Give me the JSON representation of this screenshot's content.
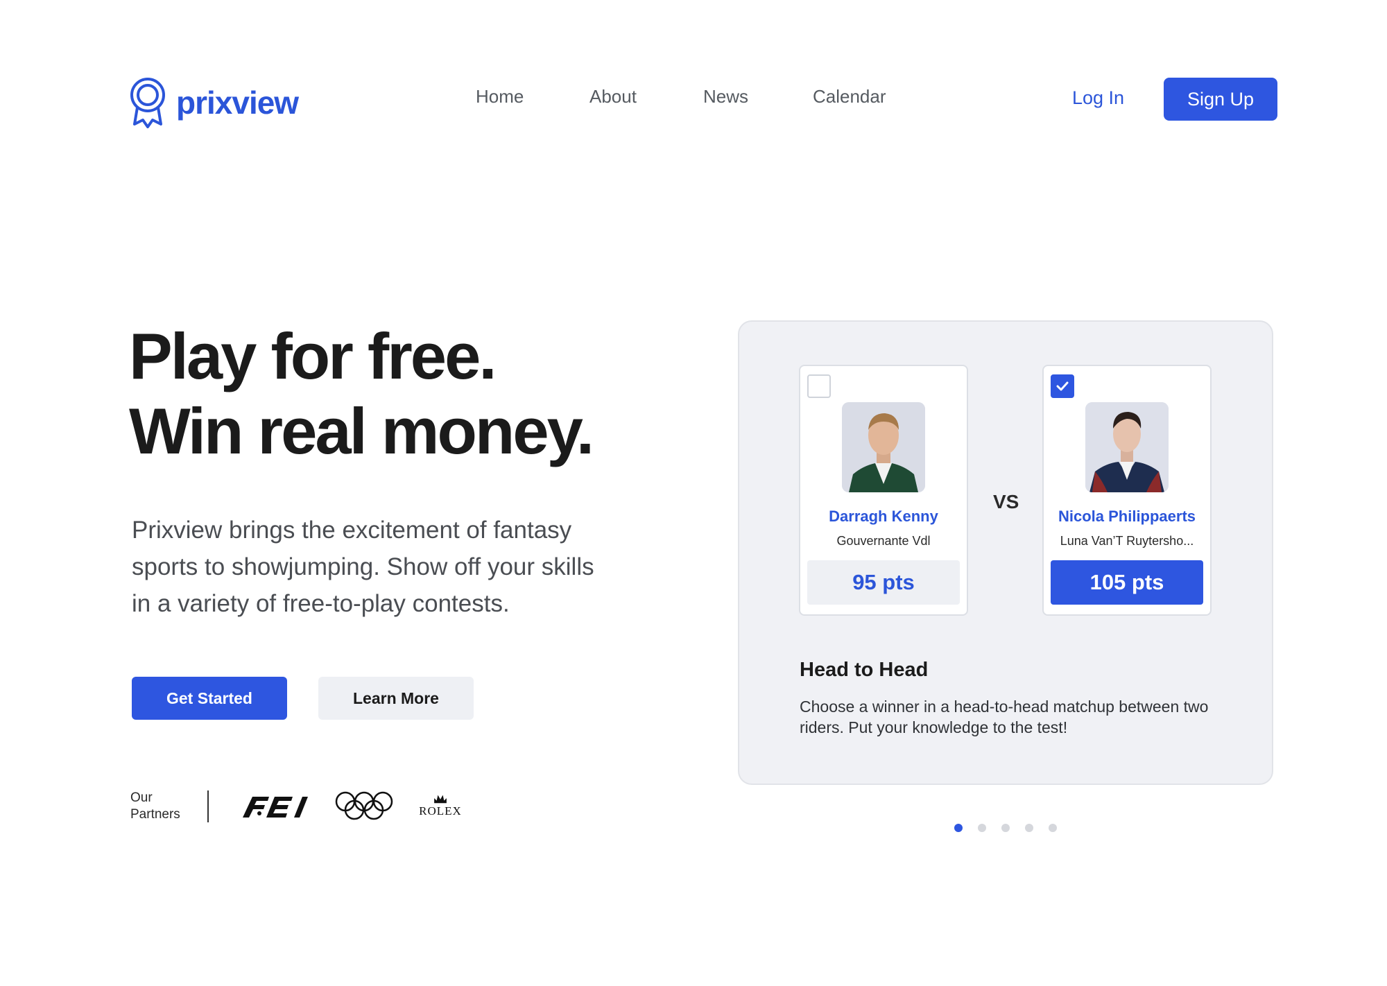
{
  "brand": {
    "name": "prixview",
    "accent": "#2e56e0"
  },
  "nav": {
    "items": [
      {
        "label": "Home"
      },
      {
        "label": "About"
      },
      {
        "label": "News"
      },
      {
        "label": "Calendar"
      }
    ],
    "login_label": "Log In",
    "signup_label": "Sign Up"
  },
  "hero": {
    "headline_line1": "Play for free.",
    "headline_line2": "Win real money.",
    "subtext": "Prixview brings the excitement of fantasy sports to showjumping. Show off your skills in a variety of free-to-play contests.",
    "primary_cta": "Get Started",
    "secondary_cta": "Learn More"
  },
  "partners": {
    "label_line1": "Our",
    "label_line2": "Partners",
    "logos": [
      {
        "name": "FEI",
        "icon": "fei-logo"
      },
      {
        "name": "Olympic Rings",
        "icon": "olympic-rings-logo"
      },
      {
        "name": "ROLEX",
        "icon": "rolex-logo"
      }
    ]
  },
  "contest_card": {
    "vs_label": "VS",
    "riders": [
      {
        "name": "Darragh Kenny",
        "horse": "Gouvernante Vdl",
        "points": "95 pts",
        "selected": false
      },
      {
        "name": "Nicola Philippaerts",
        "horse": "Luna Van’T Ruytersho...",
        "points": "105 pts",
        "selected": true
      }
    ],
    "title": "Head to Head",
    "description": "Choose a winner in a head-to-head matchup between two riders. Put your knowledge to the test!"
  },
  "carousel": {
    "total": 5,
    "active_index": 0
  }
}
